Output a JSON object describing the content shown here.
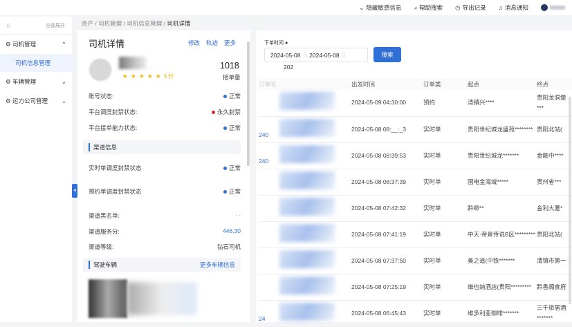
{
  "topbar": {
    "items": [
      {
        "icon": "eye-off-icon",
        "label": "隐藏敏感信息"
      },
      {
        "icon": "search-icon",
        "label": "帮助搜索"
      },
      {
        "icon": "clock-icon",
        "label": "导出记录"
      },
      {
        "icon": "bell-icon",
        "label": "消息通知"
      }
    ]
  },
  "sidebar": {
    "expand_all": "全部展开",
    "items": [
      {
        "label": "司机管理",
        "expanded": true,
        "children": [
          "司机信息管理"
        ]
      },
      {
        "label": "车辆管理"
      },
      {
        "label": "运力公司管理"
      }
    ]
  },
  "breadcrumb": [
    "资产",
    "司机管理",
    "司机信息管理",
    "司机详情"
  ],
  "driver": {
    "title": "司机详情",
    "actions": [
      "修改",
      "轨迹",
      "更多"
    ],
    "stars": "★ ★ ★ ★ ★",
    "score": "5分",
    "orders": "1018",
    "orders_label": "接单量",
    "status": [
      {
        "label": "账号状态:",
        "value": "正常",
        "color": "#2f6fd6"
      },
      {
        "label": "平台调度封禁状态:",
        "value": "永久封禁",
        "color": "#d9262c"
      },
      {
        "label": "平台接单能力状态:",
        "value": "正常",
        "color": "#2f6fd6"
      }
    ],
    "channel_title": "渠道信息",
    "channel_status": [
      {
        "label": "实时单调度封禁状态",
        "value": "正常"
      },
      {
        "label": "预约单调度封禁状态",
        "value": "正常"
      }
    ],
    "channel_info": [
      {
        "label": "渠道黑名单:",
        "value": "- -"
      },
      {
        "label": "渠道服务分:",
        "value": "446.30"
      },
      {
        "label": "渠道等级:",
        "value": "钻石司机"
      }
    ],
    "vehicle_title": "驾驶车辆",
    "vehicle_more": "更多车辆信息"
  },
  "orders": {
    "date_label": "下单时间",
    "date_start": "2024-05-08",
    "date_end": "2024-05-08",
    "search": "搜索",
    "count": "202",
    "columns": [
      "订单号",
      "出发时间",
      "订单类",
      "起点",
      "终点"
    ],
    "rows": [
      {
        "id": "",
        "time": "2024-05-09 04:30:00",
        "type": "预约",
        "start": "清镇兴****",
        "end": "贵阳龙洞堡***"
      },
      {
        "id": "240",
        "time": "2024-05-08 08:__:_3",
        "type": "实时单",
        "start": "贵阳世纪城龙盛苑********",
        "end": "贵阳北站("
      },
      {
        "id": "240",
        "time": "2024-05-08 08:39:53",
        "type": "实时单",
        "start": "贵阳世纪城龙*******",
        "end": "金融中****"
      },
      {
        "id": "",
        "time": "2024-05-08 08:37:39",
        "type": "实时单",
        "start": "国电金海域*****",
        "end": "贵州省***"
      },
      {
        "id": "",
        "time": "2024-05-08 07:42:32",
        "type": "实时单",
        "start": "黔缈**",
        "end": "金利大厦*"
      },
      {
        "id": "",
        "time": "2024-05-08 07:41:19",
        "type": "实时单",
        "start": "中天·帝景传说B区*********",
        "end": "贵阳北站("
      },
      {
        "id": "",
        "time": "2024-05-08 07:37:50",
        "type": "实时单",
        "start": "美之道(中铁*******",
        "end": "清镇市第一"
      },
      {
        "id": "",
        "time": "2024-05-08 07:25:19",
        "type": "实时单",
        "start": "维也纳酒店(贵阳*********",
        "end": "黔香阁食府"
      },
      {
        "id": "24",
        "time": "2024-05-08 06:45:43",
        "type": "实时单",
        "start": "维多利亚咖啡*******",
        "end": "三千旅居酒*******"
      }
    ]
  }
}
